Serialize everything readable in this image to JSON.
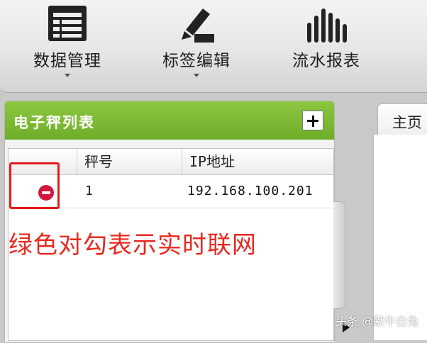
{
  "toolbar": {
    "items": [
      {
        "label": "数据管理",
        "icon": "table-list-icon"
      },
      {
        "label": "标签编辑",
        "icon": "pen-edit-icon"
      },
      {
        "label": "流水报表",
        "icon": "bar-chart-icon"
      }
    ]
  },
  "panel": {
    "title": "电子秤列表",
    "columns": [
      "秤号",
      "IP地址"
    ],
    "rows": [
      {
        "scale_no": "1",
        "ip": "192.168.100.201",
        "status_icon": "remove-icon"
      }
    ]
  },
  "annotation": "绿色对勾表示实时联网",
  "tabs": [
    "主页"
  ],
  "watermark": "头条 @默牛白兔",
  "colors": {
    "header_green": "#7cba34",
    "annotation_red": "#e8291f",
    "remove_red": "#d4163c"
  }
}
